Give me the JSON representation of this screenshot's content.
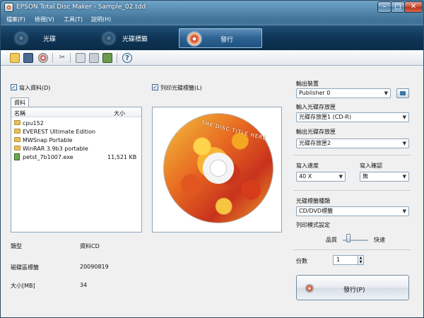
{
  "window": {
    "title": "EPSON Total Disc Maker - Sample_02.tdd"
  },
  "menu": [
    "檔案(F)",
    "檢視(V)",
    "工具(T)",
    "說明(H)"
  ],
  "modes": {
    "disc": "光碟",
    "label": "光碟標籤",
    "publish": "發行"
  },
  "write_data": {
    "label": "寫入資料(D)",
    "checked": true
  },
  "print_label": {
    "label": "列印光碟標籤(L)",
    "checked": true
  },
  "data_tab": "資料",
  "file_list": {
    "headers": {
      "name": "名稱",
      "size": "大小"
    },
    "rows": [
      {
        "name": "cpu152",
        "size": "",
        "type": "folder"
      },
      {
        "name": "EVEREST Ultimate Edition",
        "size": "",
        "type": "folder"
      },
      {
        "name": "MWSnap Portable",
        "size": "",
        "type": "folder"
      },
      {
        "name": "WinRAR 3.9b3 portable",
        "size": "",
        "type": "folder"
      },
      {
        "name": "petst_7b1007.exe",
        "size": "11,521 KB",
        "type": "file"
      }
    ]
  },
  "info": {
    "type_key": "類型",
    "type_val": "資料CD",
    "volume_key": "磁碟區標籤",
    "volume_val": "20090819",
    "size_key": "大小[MB]",
    "size_val": "34"
  },
  "disc_preview": {
    "title_text": "THE DISC TITLE HERE"
  },
  "settings": {
    "output_device_label": "輸出裝置",
    "output_device": "Publisher 0",
    "input_stacker_label": "輸入光碟存放匣",
    "input_stacker": "光碟存放匣1 (CD-R)",
    "output_stacker_label": "輸出光碟存放匣",
    "output_stacker": "光碟存放匣2",
    "write_speed_label": "寫入速度",
    "write_speed": "40 X",
    "verify_label": "寫入確認",
    "verify": "無",
    "label_type_label": "光碟標籤種類",
    "label_type": "CD/DVD標籤",
    "print_mode_label": "列印模式設定",
    "quality_label": "品質",
    "speed_label": "快速",
    "print_mode_position": 0.25,
    "copies_label": "份數",
    "copies": "1"
  },
  "publish_button": "發行(P)"
}
